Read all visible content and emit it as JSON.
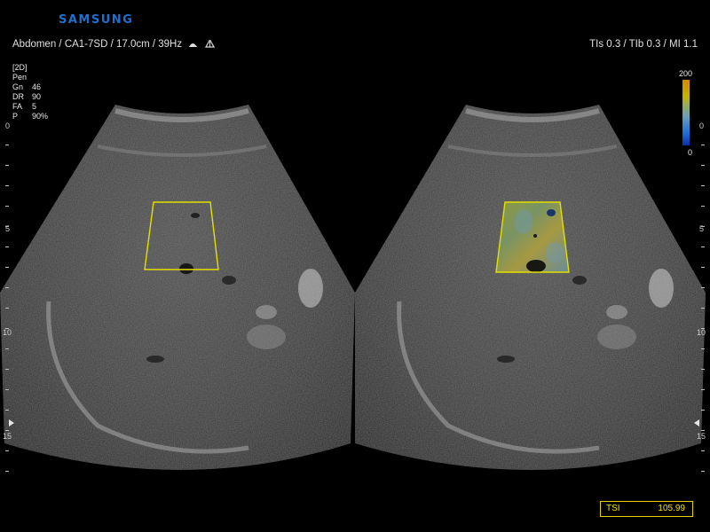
{
  "brand": "SAMSUNG",
  "header": {
    "left": "Abdomen / CA1-7SD / 17.0cm / 39Hz",
    "right": "TIs  0.3 / TIb  0.3 / MI   1.1"
  },
  "params": {
    "mode": "[2D]",
    "preset": "Pen",
    "rows": [
      {
        "key": "Gn",
        "value": "46"
      },
      {
        "key": "DR",
        "value": "90"
      },
      {
        "key": "FA",
        "value": "5"
      },
      {
        "key": "P",
        "value": "90%"
      }
    ]
  },
  "colorbar": {
    "max": "200",
    "min": "0",
    "colors": [
      "#d38a00",
      "#c3b400",
      "#6aa0b8",
      "#1c6ed8",
      "#0a2fa8"
    ]
  },
  "depth_scale": {
    "labels": [
      "0",
      "5",
      "10",
      "15"
    ]
  },
  "tsi": {
    "label": "TSI",
    "value": "105.99"
  },
  "roi_color": "#e3e000",
  "icons": [
    "probe-icon",
    "biopsy-icon",
    "focus-marker-left-icon",
    "focus-marker-right-icon"
  ]
}
